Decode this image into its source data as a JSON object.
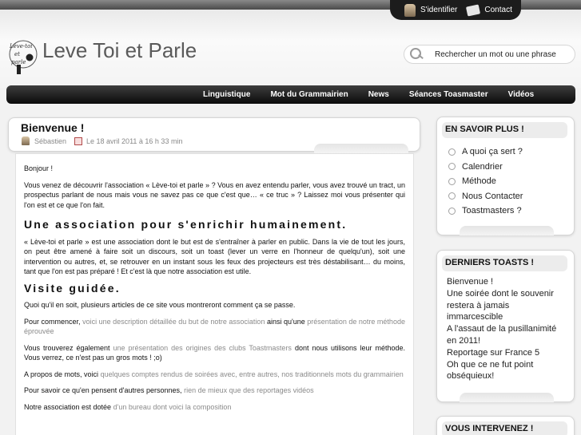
{
  "header": {
    "site_title": "Leve Toi et Parle",
    "logo_text": "Lève-toi et parle",
    "login_label": "S'identifier",
    "contact_label": "Contact",
    "search_placeholder": "Rechercher un mot ou une phrase"
  },
  "nav": [
    {
      "label": "Linguistique"
    },
    {
      "label": "Mot du Grammairien"
    },
    {
      "label": "News"
    },
    {
      "label": "Séances Toasmaster"
    },
    {
      "label": "Vidéos"
    }
  ],
  "article": {
    "title": "Bienvenue !",
    "author": "Sébastien",
    "date": "Le 18 avril 2011 à 16 h 33 min",
    "greeting": "Bonjour !",
    "intro": "Vous venez de découvrir l'association « Lève-toi et parle » ? Vous en avez entendu parler, vous avez trouvé un tract, un prospectus parlant de nous mais vous ne savez pas ce que c'est que… « ce truc » ? Laissez moi vous présenter qui l'on est et ce que l'on fait.",
    "h2_assoc": "Une association pour s'enrichir humainement.",
    "assoc_text": "« Lève-toi et parle » est une association dont le but est de s'entraîner à parler en public.  Dans la vie de tout les jours, on peut être amené à faire soit un discours, soit un toast (lever un verre en l'honneur de quelqu'un), soit une intervention ou autres, et, se retrouver en un instant sous les feux des projecteurs est très déstabilisant… du moins, tant que l'on est pas préparé ! Et c'est là que notre association est utile.",
    "h2_visite": "Visite guidée.",
    "visite_text": "Quoi qu'il en soit, plusieurs articles de ce site vous montreront comment ça se passe.",
    "p1_a": "Pour commencer,",
    "p1_link1": "voici une description détaillée du but de notre association",
    "p1_b": "ainsi qu'une",
    "p1_link2": "présentation de notre méthode éprouvée",
    "p2_a": "Vous trouverez également",
    "p2_link": "une présentation des origines des clubs Toastmasters",
    "p2_b": "dont nous utilisons leur méthode. Vous verrez, ce n'est pas un gros mots ! ;o)",
    "p3_a": "A propos de mots, voici",
    "p3_link": "quelques comptes rendus de soirées avec, entre autres, nos traditionnels mots du grammairien",
    "p4_a": "Pour savoir ce qu'en pensent d'autres personnes,",
    "p4_link": "rien de mieux que des reportages vidéos",
    "p5_a": "Notre association est dotée",
    "p5_link": "d'un bureau dont voici la composition"
  },
  "sidebar": {
    "en_savoir_title": "EN SAVOIR PLUS !",
    "en_savoir_items": [
      {
        "label": "A quoi ça sert ?"
      },
      {
        "label": "Calendrier"
      },
      {
        "label": "Méthode"
      },
      {
        "label": "Nous Contacter"
      },
      {
        "label": "Toastmasters ?"
      }
    ],
    "toasts_title": "DERNIERS TOASTS !",
    "toasts": [
      {
        "label": "Bienvenue !"
      },
      {
        "label": "Une soirée dont le souvenir restera à jamais immarcescible"
      },
      {
        "label": "A l'assaut de la pusillanimité en 2011!"
      },
      {
        "label": "Reportage sur France 5"
      },
      {
        "label": "Oh que ce ne fut point obséquieux!"
      }
    ],
    "intervenez_title": "VOUS INTERVENEZ !"
  }
}
